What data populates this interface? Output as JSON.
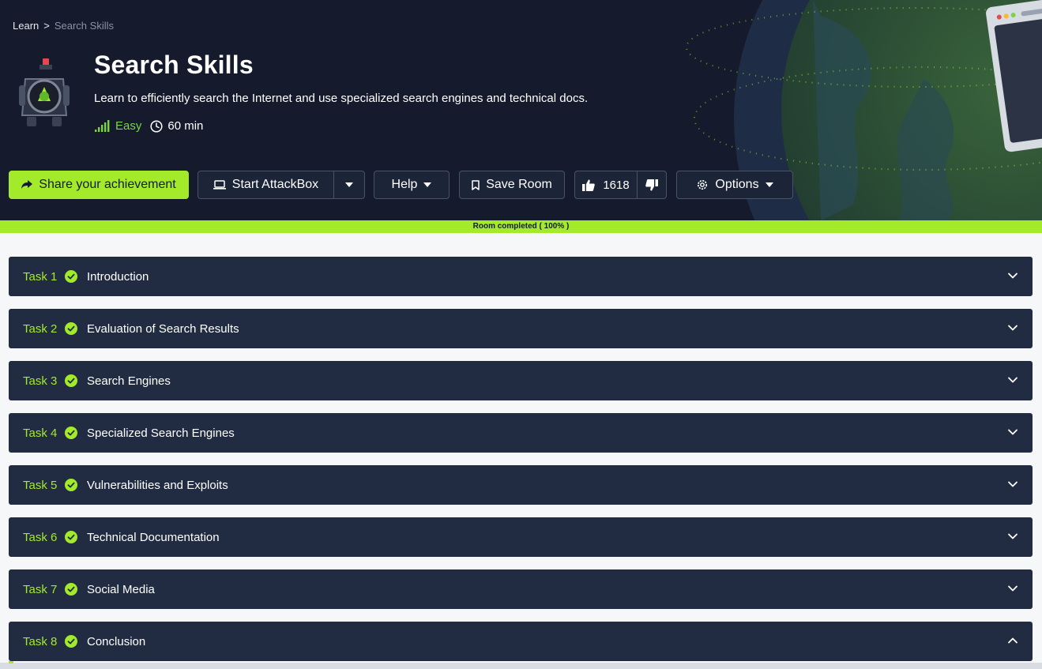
{
  "breadcrumb": {
    "home": "Learn",
    "separator": ">",
    "current": "Search Skills"
  },
  "room": {
    "title": "Search Skills",
    "description": "Learn to efficiently search the Internet and use specialized search engines and technical docs.",
    "difficulty": "Easy",
    "duration": "60 min",
    "icon": "room-robot-icon"
  },
  "actions": {
    "share": "Share your achievement",
    "attackbox": "Start AttackBox",
    "help": "Help",
    "save": "Save Room",
    "likes": "1618",
    "options": "Options"
  },
  "progress": {
    "label": "Room completed ( 100% )",
    "percent": 100
  },
  "tasks": [
    {
      "number": "Task 1",
      "title": "Introduction",
      "completed": true,
      "expanded": false
    },
    {
      "number": "Task 2",
      "title": "Evaluation of Search Results",
      "completed": true,
      "expanded": false
    },
    {
      "number": "Task 3",
      "title": "Search Engines",
      "completed": true,
      "expanded": false
    },
    {
      "number": "Task 4",
      "title": "Specialized Search Engines",
      "completed": true,
      "expanded": false
    },
    {
      "number": "Task 5",
      "title": "Vulnerabilities and Exploits",
      "completed": true,
      "expanded": false
    },
    {
      "number": "Task 6",
      "title": "Technical Documentation",
      "completed": true,
      "expanded": false
    },
    {
      "number": "Task 7",
      "title": "Social Media",
      "completed": true,
      "expanded": false
    },
    {
      "number": "Task 8",
      "title": "Conclusion",
      "completed": true,
      "expanded": true
    }
  ],
  "colors": {
    "accent": "#a3ea2a",
    "hero_bg": "#151b2c",
    "task_bg": "#212c42",
    "difficulty_easy": "#7bd34a"
  }
}
